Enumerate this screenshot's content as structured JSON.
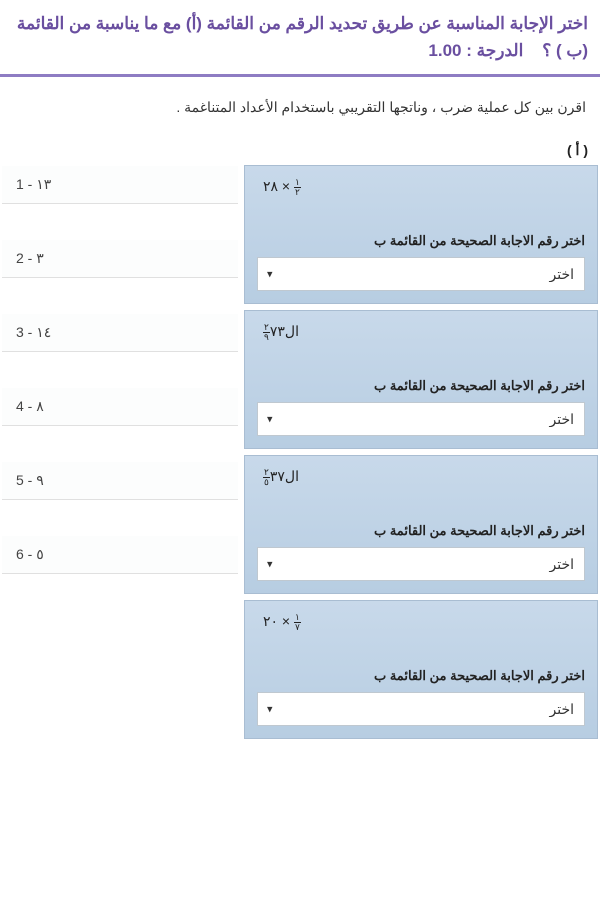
{
  "header": {
    "title_main": "اختر الإجابة المناسبة عن طريق تحديد الرقم من القائمة (أ) مع ما يناسبة من القائمة (ب ) ؟",
    "grade_label": "الدرجة :",
    "grade_value": "1.00"
  },
  "instruction": "اقرن بين كل عملية ضرب ، وناتجها التقريبي باستخدام الأعداد المتناغمة .",
  "column_a_header": "( أ )",
  "column_b": [
    {
      "num": "1",
      "val": "١٣"
    },
    {
      "num": "2",
      "val": "٣"
    },
    {
      "num": "3",
      "val": "١٤"
    },
    {
      "num": "4",
      "val": "٨"
    },
    {
      "num": "5",
      "val": "٩"
    },
    {
      "num": "6",
      "val": "٥"
    }
  ],
  "column_a": [
    {
      "expr_html": "٢٨ × <span class='frac'><span class='n'>١</span><span class='d'>٢</span></span>",
      "label": "اختر رقم الاجابة الصحيحة من القائمة ب",
      "placeholder": "اختر"
    },
    {
      "expr_html": "<span class='frac'><span class='n'>٢</span><span class='d'>٩</span></span>ال٧٣",
      "label": "اختر رقم الاجابة الصحيحة من القائمة ب",
      "placeholder": "اختر"
    },
    {
      "expr_html": "<span class='frac'><span class='n'>٢</span><span class='d'>٥</span></span>ال٣٧",
      "label": "اختر رقم الاجابة الصحيحة من القائمة ب",
      "placeholder": "اختر"
    },
    {
      "expr_html": "٢٠ × <span class='frac'><span class='n'>١</span><span class='d'>٧</span></span>",
      "label": "اختر رقم الاجابة الصحيحة من القائمة ب",
      "placeholder": "اختر"
    }
  ]
}
